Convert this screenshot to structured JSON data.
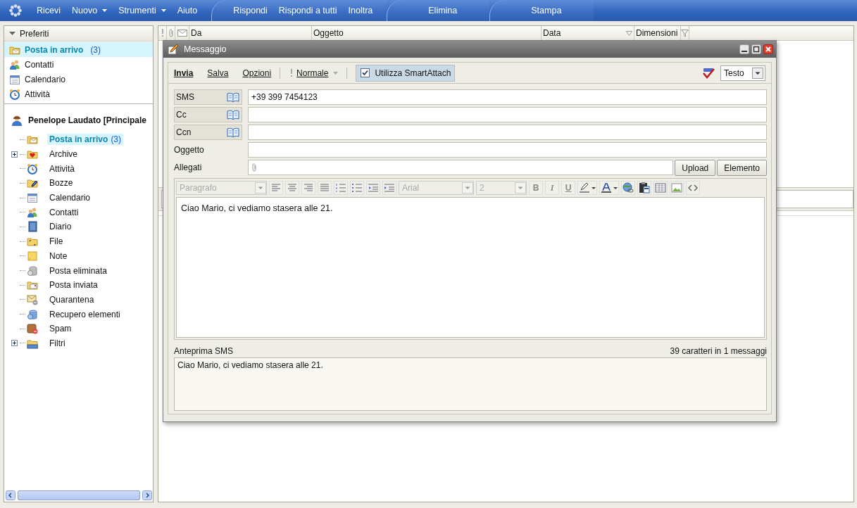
{
  "toolbar": {
    "groups": [
      {
        "items": [
          {
            "label": "Ricevi",
            "dropdown": false
          },
          {
            "label": "Nuovo",
            "dropdown": true
          },
          {
            "label": "Strumenti",
            "dropdown": true
          },
          {
            "label": "Aiuto",
            "dropdown": false
          }
        ]
      },
      {
        "items": [
          {
            "label": "Rispondi",
            "dropdown": false
          },
          {
            "label": "Rispondi a tutti",
            "dropdown": false
          },
          {
            "label": "Inoltra",
            "dropdown": false
          }
        ]
      },
      {
        "items": [
          {
            "label": "Elimina",
            "dropdown": false
          }
        ]
      },
      {
        "items": [
          {
            "label": "Stampa",
            "dropdown": false
          }
        ]
      }
    ]
  },
  "sidebar": {
    "favorites": {
      "title": "Preferiti",
      "expanded": true,
      "items": [
        {
          "label": "Posta in arrivo",
          "count": "(3)",
          "selected": true
        },
        {
          "label": "Contatti",
          "selected": false
        },
        {
          "label": "Calendario",
          "selected": false
        },
        {
          "label": "Attività",
          "selected": false
        }
      ]
    },
    "account": {
      "name": "Penelope Laudato [Principale",
      "folders": [
        {
          "label": "Posta in arrivo",
          "count": "(3)",
          "selected": true,
          "expandable": false
        },
        {
          "label": "Archive",
          "selected": false,
          "expandable": true
        },
        {
          "label": "Attività",
          "selected": false,
          "expandable": false
        },
        {
          "label": "Bozze",
          "selected": false,
          "expandable": false
        },
        {
          "label": "Calendario",
          "selected": false,
          "expandable": false
        },
        {
          "label": "Contatti",
          "selected": false,
          "expandable": false
        },
        {
          "label": "Diario",
          "selected": false,
          "expandable": false
        },
        {
          "label": "File",
          "selected": false,
          "expandable": false
        },
        {
          "label": "Note",
          "selected": false,
          "expandable": false
        },
        {
          "label": "Posta eliminata",
          "selected": false,
          "expandable": false
        },
        {
          "label": "Posta inviata",
          "selected": false,
          "expandable": false
        },
        {
          "label": "Quarantena",
          "selected": false,
          "expandable": false
        },
        {
          "label": "Recupero elementi",
          "selected": false,
          "expandable": false
        },
        {
          "label": "Spam",
          "selected": false,
          "expandable": false
        },
        {
          "label": "Filtri",
          "selected": false,
          "expandable": true
        }
      ]
    }
  },
  "message_list": {
    "columns": [
      {
        "label": "Da",
        "sorted": false
      },
      {
        "label": "Oggetto",
        "sorted": false
      },
      {
        "label": "Data",
        "sorted": true
      },
      {
        "label": "Dimensioni",
        "sorted": false
      }
    ]
  },
  "dialog": {
    "title": "Messaggio",
    "actions": [
      {
        "label": "Invia",
        "primary": true
      },
      {
        "label": "Salva",
        "primary": false
      },
      {
        "label": "Opzioni",
        "primary": false
      }
    ],
    "priority": "Normale",
    "smart_attach": {
      "label": "Utilizza SmartAttach",
      "checked": true
    },
    "format": "Testo",
    "fields": [
      {
        "kind": "address",
        "label": "SMS",
        "value": "+39 399 7454123"
      },
      {
        "kind": "address",
        "label": "Cc"
      },
      {
        "kind": "address",
        "label": "Ccn"
      },
      {
        "kind": "text",
        "label": "Oggetto"
      },
      {
        "kind": "attachment",
        "label": "Allegati",
        "buttons": [
          "Upload",
          "Elemento"
        ]
      }
    ],
    "editor": {
      "paragraph": "Paragrafo",
      "font": "Arial",
      "size": "2",
      "disabled": true,
      "format_buttons": [
        "B",
        "I",
        "U"
      ],
      "body": "Ciao Mario, ci vediamo stasera alle 21."
    },
    "preview": {
      "label": "Anteprima SMS",
      "counter": "39 caratteri in 1 messaggi",
      "text": "Ciao Mario, ci vediamo stasera alle 21."
    }
  }
}
